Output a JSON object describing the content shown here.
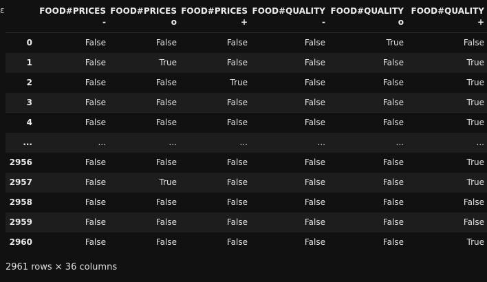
{
  "left_tick": "ε",
  "columns": [
    {
      "top": "FOOD#PRICES",
      "sub": "-"
    },
    {
      "top": "FOOD#PRICES",
      "sub": "o"
    },
    {
      "top": "FOOD#PRICES",
      "sub": "+"
    },
    {
      "top": "FOOD#QUALITY",
      "sub": "-"
    },
    {
      "top": "FOOD#QUALITY",
      "sub": "o"
    },
    {
      "top": "FOOD#QUALITY",
      "sub": "+"
    }
  ],
  "rows": [
    {
      "index": "0",
      "cells": [
        "False",
        "False",
        "False",
        "False",
        "True",
        "False"
      ]
    },
    {
      "index": "1",
      "cells": [
        "False",
        "True",
        "False",
        "False",
        "False",
        "True"
      ]
    },
    {
      "index": "2",
      "cells": [
        "False",
        "False",
        "True",
        "False",
        "False",
        "True"
      ]
    },
    {
      "index": "3",
      "cells": [
        "False",
        "False",
        "False",
        "False",
        "False",
        "True"
      ]
    },
    {
      "index": "4",
      "cells": [
        "False",
        "False",
        "False",
        "False",
        "False",
        "True"
      ]
    },
    {
      "index": "...",
      "cells": [
        "...",
        "...",
        "...",
        "...",
        "...",
        "..."
      ]
    },
    {
      "index": "2956",
      "cells": [
        "False",
        "False",
        "False",
        "False",
        "False",
        "True"
      ]
    },
    {
      "index": "2957",
      "cells": [
        "False",
        "True",
        "False",
        "False",
        "False",
        "True"
      ]
    },
    {
      "index": "2958",
      "cells": [
        "False",
        "False",
        "False",
        "False",
        "False",
        "False"
      ]
    },
    {
      "index": "2959",
      "cells": [
        "False",
        "False",
        "False",
        "False",
        "False",
        "False"
      ]
    },
    {
      "index": "2960",
      "cells": [
        "False",
        "False",
        "False",
        "False",
        "False",
        "True"
      ]
    }
  ],
  "footer": "2961 rows × 36 columns"
}
